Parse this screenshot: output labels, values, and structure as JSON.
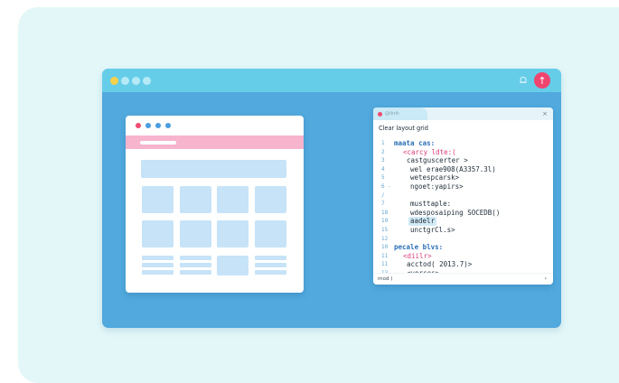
{
  "titlebar": {
    "dot_colors": [
      "#f7d04c",
      "#b6eaf7",
      "#b6eaf7",
      "#b6eaf7"
    ],
    "bell_icon": "bell-icon",
    "upload_icon": "arrow-up-icon",
    "upload_glyph": "↑"
  },
  "wireframe": {
    "dot_colors": [
      "#ef4b6f",
      "#4a9ee0",
      "#4a9ee0",
      "#4a9ee0"
    ]
  },
  "editor": {
    "tab_label": "@ibrik",
    "close_glyph": "×",
    "title": "Clear layout grid",
    "lines": [
      {
        "num": "1",
        "text": "maata cas:",
        "style": "kw"
      },
      {
        "num": "2",
        "text": "<carcy ldte:(",
        "style": "pk"
      },
      {
        "num": "3",
        "text": "castguscerter >",
        "style": ""
      },
      {
        "num": "4",
        "text": "wel erae908(A3357.3l)",
        "style": ""
      },
      {
        "num": "5",
        "text": "wetespcarsk>",
        "style": ""
      },
      {
        "num": "6 -",
        "text": "ngoet:yapirs>",
        "style": ""
      },
      {
        "num": "/",
        "text": "",
        "style": ""
      },
      {
        "num": "7",
        "text": "musttaple:",
        "style": ""
      },
      {
        "num": "18",
        "text": "wdesposaiping SOCEDB()",
        "style": ""
      },
      {
        "num": "19",
        "text": "aadelr",
        "style": "hl"
      },
      {
        "num": "15",
        "text": "unctgrCl.s>",
        "style": ""
      },
      {
        "num": "12",
        "text": "",
        "style": ""
      },
      {
        "num": "10",
        "text": "pecale blvs:",
        "style": "kw"
      },
      {
        "num": "11",
        "text": "<diilr>",
        "style": "pk"
      },
      {
        "num": "11",
        "text": "acctod( 2013.7)>",
        "style": ""
      },
      {
        "num": "13",
        "text": "<vorces>",
        "style": ""
      }
    ],
    "footer_label": "mod )",
    "footer_arrow": "›"
  }
}
